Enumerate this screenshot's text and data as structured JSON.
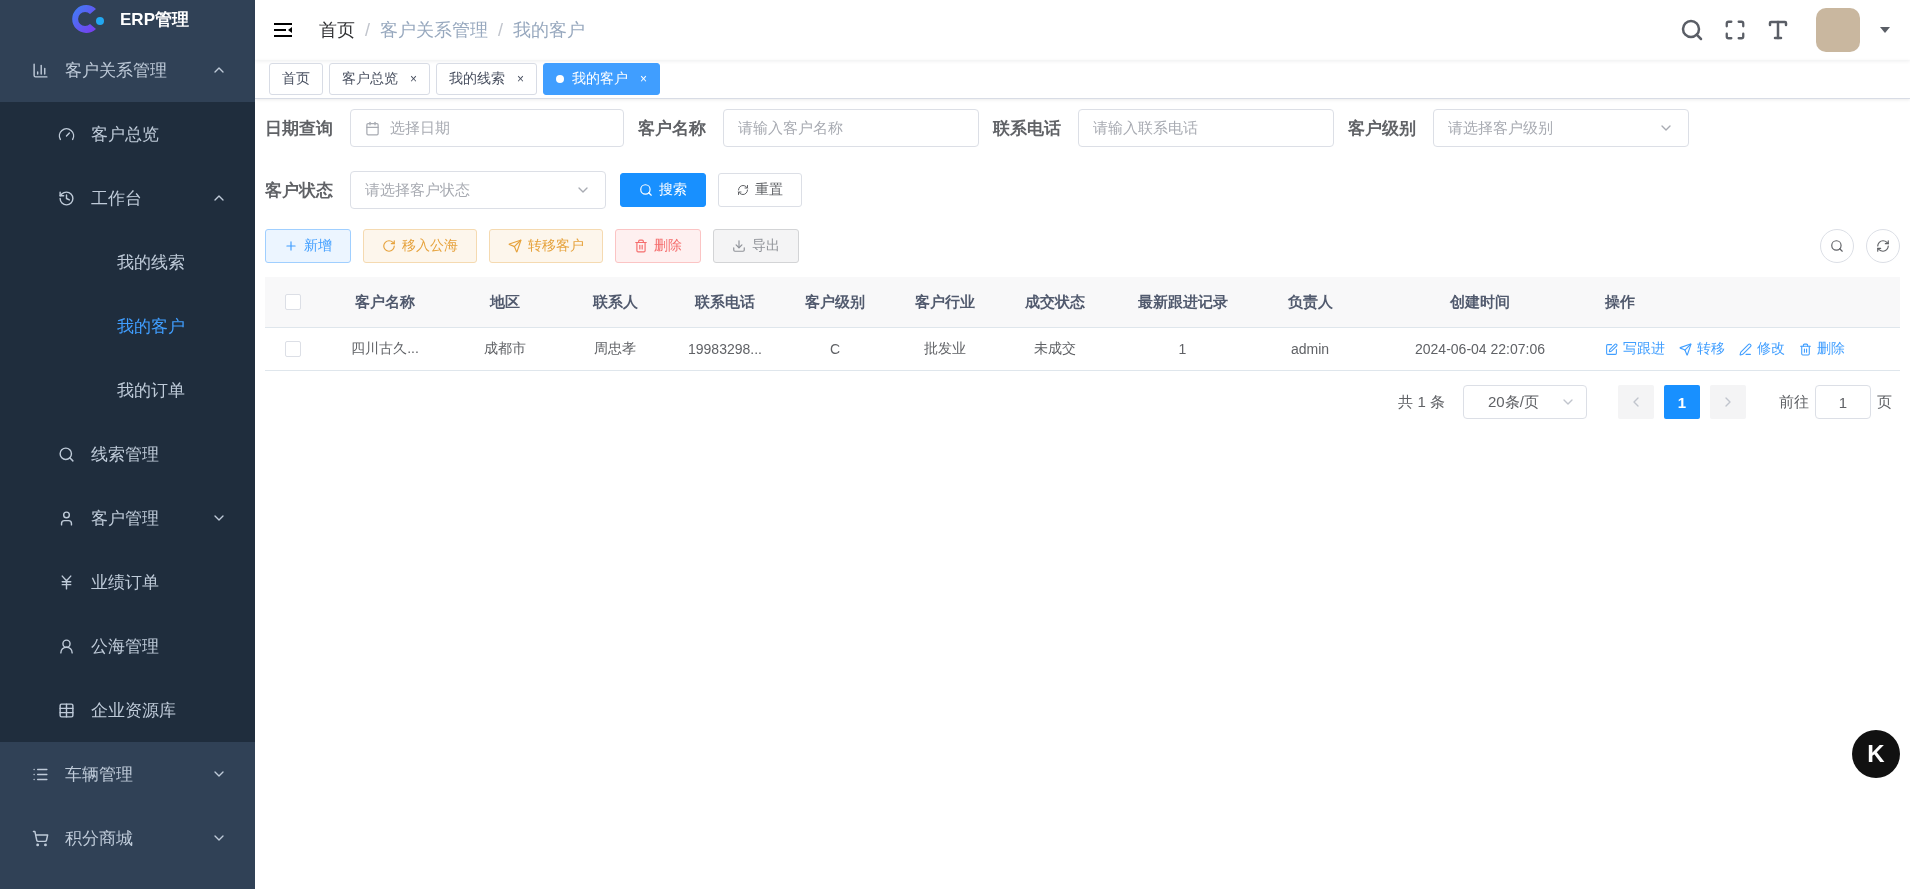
{
  "app": {
    "title": "ERP管理"
  },
  "sidebar": {
    "items": [
      {
        "label": "客户关系管理",
        "expanded": true,
        "selected": false,
        "children": [
          {
            "label": "客户总览",
            "selected": false
          },
          {
            "label": "工作台",
            "expanded": true,
            "selected": false,
            "children": [
              {
                "label": "我的线索",
                "selected": false
              },
              {
                "label": "我的客户",
                "selected": true
              },
              {
                "label": "我的订单",
                "selected": false
              }
            ]
          },
          {
            "label": "线索管理",
            "selected": false
          },
          {
            "label": "客户管理",
            "expanded": false,
            "selected": false
          },
          {
            "label": "业绩订单",
            "selected": false
          },
          {
            "label": "公海管理",
            "selected": false
          },
          {
            "label": "企业资源库",
            "selected": false
          }
        ]
      },
      {
        "label": "车辆管理",
        "expanded": false,
        "selected": false
      },
      {
        "label": "积分商城",
        "expanded": false,
        "selected": false
      }
    ]
  },
  "breadcrumb": [
    "首页",
    "客户关系管理",
    "我的客户"
  ],
  "breadcrumb_separator": "/",
  "tabs": [
    {
      "label": "首页",
      "selected": false,
      "closable": false
    },
    {
      "label": "客户总览",
      "selected": false,
      "closable": true
    },
    {
      "label": "我的线索",
      "selected": false,
      "closable": true
    },
    {
      "label": "我的客户",
      "selected": true,
      "closable": true
    }
  ],
  "tab_close": "×",
  "filters": [
    {
      "label": "日期查询",
      "kind": "date",
      "placeholder": "选择日期"
    },
    {
      "label": "客户名称",
      "kind": "text",
      "placeholder": "请输入客户名称"
    },
    {
      "label": "联系电话",
      "kind": "text",
      "placeholder": "请输入联系电话"
    },
    {
      "label": "客户级别",
      "kind": "select",
      "placeholder": "请选择客户级别"
    },
    {
      "label": "客户状态",
      "kind": "select",
      "placeholder": "请选择客户状态"
    }
  ],
  "search_button": "搜索",
  "reset_button": "重置",
  "actions": [
    {
      "label": "新增",
      "kind": "add"
    },
    {
      "label": "移入公海",
      "kind": "move"
    },
    {
      "label": "转移客户",
      "kind": "transfer"
    },
    {
      "label": "删除",
      "kind": "delete"
    },
    {
      "label": "导出",
      "kind": "export"
    }
  ],
  "table": {
    "columns": [
      "客户名称",
      "地区",
      "联系人",
      "联系电话",
      "客户级别",
      "客户行业",
      "成交状态",
      "最新跟进记录",
      "负责人",
      "创建时间",
      "操作"
    ],
    "all_checked": false,
    "rows": [
      {
        "checked": false,
        "cells": [
          "四川古久...",
          "成都市",
          "周忠孝",
          "19983298...",
          "C",
          "批发业",
          "未成交",
          "1",
          "admin",
          "2024-06-04 22:07:06"
        ],
        "operations": [
          {
            "label": "写跟进",
            "kind": "follow"
          },
          {
            "label": "转移",
            "kind": "transfer"
          },
          {
            "label": "修改",
            "kind": "edit"
          },
          {
            "label": "删除",
            "kind": "delete"
          }
        ]
      }
    ]
  },
  "pagination": {
    "total": "共 1 条",
    "page_size": "20条/页",
    "pages": [
      {
        "label": "1",
        "selected": true
      }
    ],
    "goto_label": "前往",
    "goto_value": "1",
    "page_suffix": "页"
  },
  "floating_badge": "K"
}
